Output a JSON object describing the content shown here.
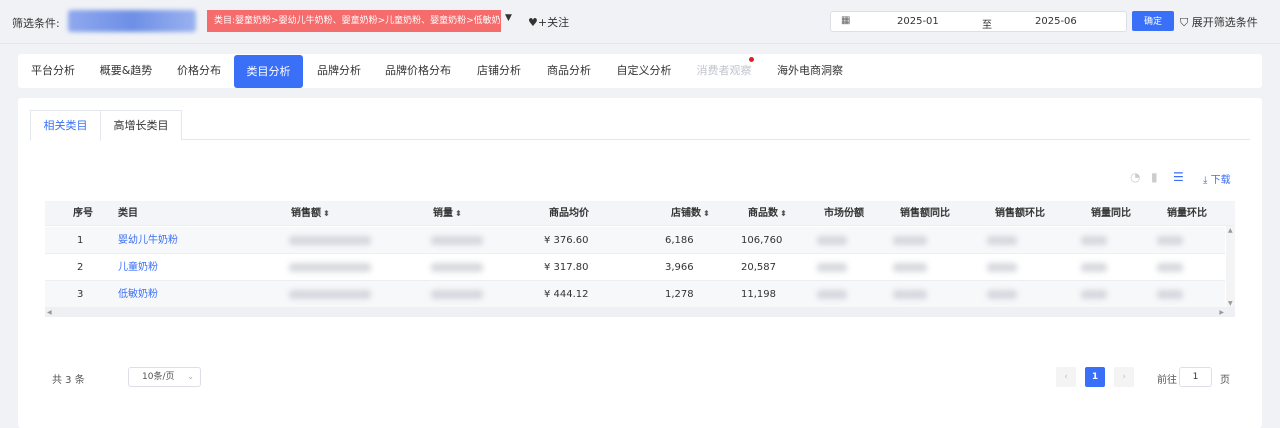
{
  "filter": {
    "label": "筛选条件:",
    "category_tag": "类目:婴童奶粉>婴幼儿牛奶粉、婴童奶粉>儿童奶粉、婴童奶粉>低敏奶粉",
    "follow_label": "♥+关注",
    "date_start": "2025-01",
    "date_separator": "至",
    "date_end": "2025-06",
    "confirm_label": "确定",
    "expand_label": "展开筛选条件"
  },
  "nav": {
    "tabs": [
      "平台分析",
      "概要&趋势",
      "价格分布",
      "类目分析",
      "品牌分析",
      "品牌价格分布",
      "店铺分析",
      "商品分析",
      "自定义分析",
      "消费者观察",
      "海外电商洞察"
    ],
    "active_index": 3,
    "disabled_index": 9
  },
  "subtabs": [
    "相关类目",
    "高增长类目"
  ],
  "toolbar": {
    "download_label": "下载"
  },
  "table": {
    "columns": [
      "序号",
      "类目",
      "销售额",
      "销量",
      "商品均价",
      "店铺数",
      "商品数",
      "市场份额",
      "销售额同比",
      "销售额环比",
      "销量同比",
      "销量环比"
    ],
    "sortable": [
      false,
      false,
      true,
      true,
      false,
      true,
      true,
      false,
      false,
      false,
      false,
      false
    ],
    "rows": [
      {
        "index": "1",
        "category": "婴幼儿牛奶粉",
        "avg_price": "¥ 376.60",
        "shops": "6,186",
        "products": "106,760"
      },
      {
        "index": "2",
        "category": "儿童奶粉",
        "avg_price": "¥ 317.80",
        "shops": "3,966",
        "products": "20,587"
      },
      {
        "index": "3",
        "category": "低敏奶粉",
        "avg_price": "¥ 444.12",
        "shops": "1,278",
        "products": "11,198"
      }
    ]
  },
  "pagination": {
    "total": "共 3 条",
    "page_size": "10条/页",
    "current_page": "1",
    "goto_label": "前往",
    "goto_value": "1",
    "goto_unit": "页"
  },
  "colors": {
    "accent": "#3a6ff7",
    "tag": "#f56c6c",
    "dot": "#e02020"
  }
}
